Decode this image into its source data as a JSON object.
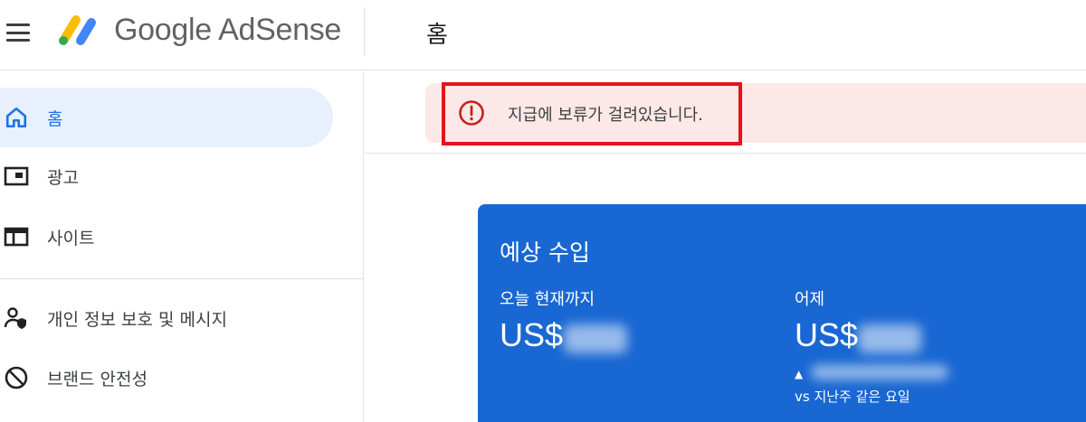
{
  "header": {
    "brand": "Google AdSense",
    "page_title": "홈"
  },
  "sidebar": {
    "items": [
      {
        "label": "홈",
        "icon": "home-icon",
        "active": true
      },
      {
        "label": "광고",
        "icon": "ads-icon"
      },
      {
        "label": "사이트",
        "icon": "sites-icon"
      },
      {
        "label": "개인 정보 보호 및 메시지",
        "icon": "privacy-icon"
      },
      {
        "label": "브랜드 안전성",
        "icon": "block-icon"
      }
    ]
  },
  "alert": {
    "icon": "error-icon",
    "message": "지급에 보류가 걸려있습니다."
  },
  "earnings": {
    "title": "예상 수입",
    "today_label": "오늘 현재까지",
    "today_value": "US$",
    "yesterday_label": "어제",
    "yesterday_value": "US$",
    "compare_arrow": "▲",
    "compare_text": "vs 지난주 같은 요일"
  },
  "colors": {
    "accent": "#1a73e8",
    "card": "#1967d2",
    "alert_bg": "#fce8e6",
    "alert_red": "#c5221f",
    "highlight_box": "#e1141f"
  }
}
